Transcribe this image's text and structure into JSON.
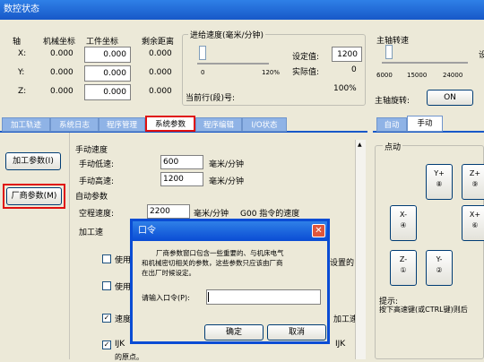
{
  "window": {
    "title": "数控状态"
  },
  "axes": {
    "headers": [
      "轴",
      "机械坐标",
      "工件坐标",
      "剩余距离"
    ],
    "rows": [
      {
        "name": "X:",
        "machine": "0.000",
        "work": "0.000",
        "remain": "0.000"
      },
      {
        "name": "Y:",
        "machine": "0.000",
        "work": "0.000",
        "remain": "0.000"
      },
      {
        "name": "Z:",
        "machine": "0.000",
        "work": "0.000",
        "remain": "0.000"
      }
    ]
  },
  "feed": {
    "title": "进给速度(毫米/分钟)",
    "scale_min": "0",
    "scale_max": "120%",
    "set_label": "设定值:",
    "set_value": "1200",
    "actual_label": "实际值:",
    "actual_value": "0",
    "percent": "100%",
    "current_line_label": "当前行(段)号:"
  },
  "spindle": {
    "title": "主轴转速",
    "set_label_partial": "设",
    "scale": [
      "6000",
      "15000",
      "24000"
    ],
    "rotate_label": "主轴旋转:",
    "on_label": "ON"
  },
  "tabs": [
    "加工轨迹",
    "系统日志",
    "程序管理",
    "系统参数",
    "程序编辑",
    "I/O状态"
  ],
  "active_tab": "系统参数",
  "right_tabs": [
    "自动",
    "手动"
  ],
  "left_buttons": {
    "process_params": "加工参数(I)",
    "vendor_params": "厂商参数(M)"
  },
  "params": {
    "manual_speed": "手动速度",
    "manual_low_label": "手动低速:",
    "manual_low_value": "600",
    "manual_low_unit": "毫米/分钟",
    "manual_high_label": "手动高速:",
    "manual_high_value": "1200",
    "manual_high_unit": "毫米/分钟",
    "auto_params": "自动参数",
    "travel_label": "空程速度:",
    "travel_value": "2200",
    "travel_unit": "毫米/分钟",
    "travel_note": "G00 指令的速度",
    "process_speed_partial": "加工速",
    "check_rows": [
      {
        "text": "使用",
        "checked": false,
        "right": "设置的"
      },
      {
        "text": "使用",
        "checked": false,
        "right": ""
      },
      {
        "text": "速度",
        "checked": true,
        "right": "加工速"
      },
      {
        "text": "IJK",
        "checked": true,
        "right": "IJK"
      }
    ],
    "footer_partial": "的原点。"
  },
  "jog": {
    "label": "点动",
    "buttons": [
      {
        "line1": "Y+",
        "line2": "⑧"
      },
      {
        "line1": "Z+",
        "line2": "⑨"
      },
      {
        "line1": "X-",
        "line2": "④"
      },
      {
        "line1": "X+",
        "line2": "⑥"
      },
      {
        "line1": "Z-",
        "line2": "①"
      },
      {
        "line1": "Y-",
        "line2": "②"
      }
    ],
    "tip_title": "提示:",
    "tip_text": "按下高速键(或CTRL键)则后"
  },
  "dialog": {
    "title": "口令",
    "message_line1": "厂商参数窗口包含一些重要的、与机床电气",
    "message_line2": "和机械密切相关的参数，这些参数只应该由厂商",
    "message_line3": "在出厂时候设定。",
    "prompt_label": "请输入口令(P):",
    "password_value": "",
    "ok_label": "确定",
    "cancel_label": "取消",
    "close_glyph": "✕"
  }
}
